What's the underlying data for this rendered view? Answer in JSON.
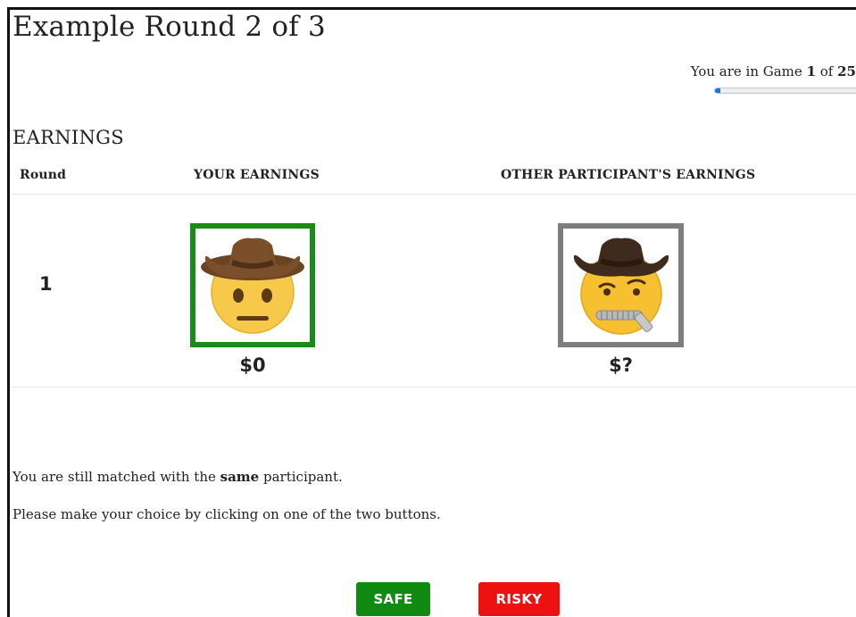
{
  "page": {
    "title": "Example Round 2 of 3"
  },
  "progress": {
    "prefix": "You are in Game ",
    "current": "1",
    "middle": " of ",
    "total": "25",
    "fraction": 0.04,
    "bar_color": "#1a73e8"
  },
  "earnings": {
    "heading": "EARNINGS",
    "columns": {
      "round": "Round",
      "yours": "YOUR EARNINGS",
      "other": "OTHER PARTICIPANT'S EARNINGS"
    },
    "rows": [
      {
        "round": "1",
        "your_amount": "$0",
        "your_icon": "cowboy-neutral-face-icon",
        "your_border_color": "#1a8a1a",
        "other_amount": "$?",
        "other_icon": "cowboy-zipper-mouth-face-icon",
        "other_border_color": "#7d7d7d"
      }
    ]
  },
  "messages": {
    "matched_prefix": "You are still matched with the ",
    "matched_bold": "same",
    "matched_suffix": " participant.",
    "instruction": "Please make your choice by clicking on one of the two buttons."
  },
  "buttons": {
    "safe": {
      "label": "SAFE",
      "color": "#118a11"
    },
    "risky": {
      "label": "RISKY",
      "color": "#ee1111"
    }
  }
}
